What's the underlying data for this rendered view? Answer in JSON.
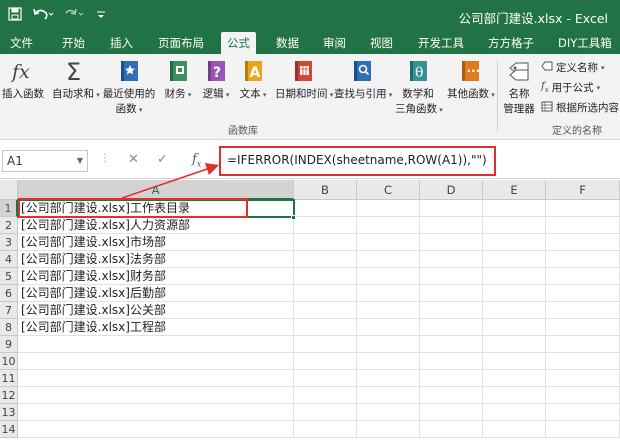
{
  "app": {
    "window_title": "公司部门建设.xlsx - Excel",
    "qat": {
      "save_icon": "save-icon",
      "undo_icon": "undo-icon",
      "redo_icon": "redo-icon"
    }
  },
  "colors": {
    "excel_green": "#217346",
    "highlight_red": "#e0302b"
  },
  "tabs": [
    "文件",
    "开始",
    "插入",
    "页面布局",
    "公式",
    "数据",
    "审阅",
    "视图",
    "开发工具",
    "方方格子",
    "DIY工具箱"
  ],
  "active_tab": "公式",
  "ribbon": {
    "function_library": {
      "group_label": "函数库",
      "buttons": [
        {
          "label": "插入函数",
          "icon": "fx-icon"
        },
        {
          "label": "自动求和",
          "icon": "sigma-icon"
        },
        {
          "label": "最近使用的",
          "label2": "函数",
          "icon": "star-book-icon"
        },
        {
          "label": "财务",
          "icon": "finance-book-icon"
        },
        {
          "label": "逻辑",
          "icon": "question-book-icon"
        },
        {
          "label": "文本",
          "icon": "text-book-icon"
        },
        {
          "label": "日期和时间",
          "icon": "calendar-book-icon"
        },
        {
          "label": "查找与引用",
          "icon": "search-book-icon"
        },
        {
          "label": "数学和",
          "label2": "三角函数",
          "icon": "theta-book-icon"
        },
        {
          "label": "其他函数",
          "icon": "more-book-icon"
        }
      ]
    },
    "defined_names": {
      "group_label": "定义的名称",
      "name_manager": {
        "label": "名称",
        "label2": "管理器"
      },
      "define_name": "定义名称",
      "use_in_formula": "用于公式",
      "create_from_selection": "根据所选内容"
    }
  },
  "formula_bar": {
    "name_box": "A1",
    "formula": "=IFERROR(INDEX(sheetname,ROW(A1)),\"\")"
  },
  "sheet": {
    "columns": [
      "A",
      "B",
      "C",
      "D",
      "E",
      "F"
    ],
    "rows": [
      "1",
      "2",
      "3",
      "4",
      "5",
      "6",
      "7",
      "8",
      "9",
      "10",
      "11",
      "12",
      "13",
      "14"
    ],
    "cells_a": [
      "[公司部门建设.xlsx]工作表目录",
      "[公司部门建设.xlsx]人力资源部",
      "[公司部门建设.xlsx]市场部",
      "[公司部门建设.xlsx]法务部",
      "[公司部门建设.xlsx]财务部",
      "[公司部门建设.xlsx]后勤部",
      "[公司部门建设.xlsx]公关部",
      "[公司部门建设.xlsx]工程部"
    ],
    "selected_cell": "A1"
  }
}
